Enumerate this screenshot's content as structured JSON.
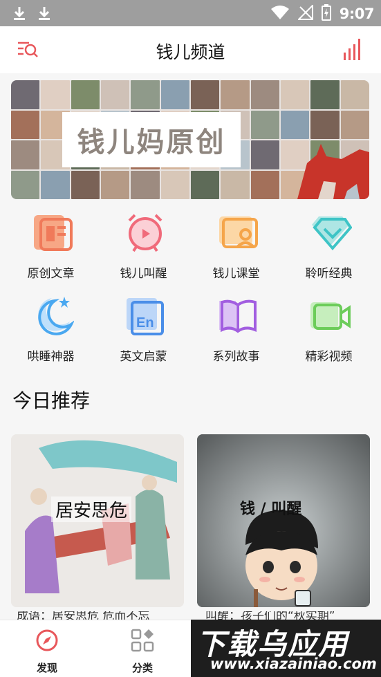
{
  "status_bar": {
    "time": "9:07"
  },
  "app_bar": {
    "title": "钱儿频道"
  },
  "banner": {
    "text": "钱儿妈原创"
  },
  "categories": [
    {
      "label": "原创文章",
      "icon": "article-icon",
      "color": "#f07a5a"
    },
    {
      "label": "钱儿叫醒",
      "icon": "alarm-clock-icon",
      "color": "#f06a7a"
    },
    {
      "label": "钱儿课堂",
      "icon": "classroom-icon",
      "color": "#f5a54a"
    },
    {
      "label": "聆听经典",
      "icon": "diamond-icon",
      "color": "#3ec4c6"
    },
    {
      "label": "哄睡神器",
      "icon": "moon-icon",
      "color": "#4aa8f0"
    },
    {
      "label": "英文启蒙",
      "icon": "english-book-icon",
      "color": "#4a8ee8"
    },
    {
      "label": "系列故事",
      "icon": "open-book-icon",
      "color": "#a25ee0"
    },
    {
      "label": "精彩视频",
      "icon": "video-camera-icon",
      "color": "#6ccc5a"
    }
  ],
  "recommend": {
    "title": "今日推荐",
    "cards": [
      {
        "image_text": "居安思危",
        "caption": "成语：居安思危 危而不忘"
      },
      {
        "image_text": "钱 / 叫醒",
        "caption": "叫醒：孩子们的“秋实期”"
      }
    ]
  },
  "tabbar": {
    "items": [
      {
        "label": "发现",
        "icon": "compass-icon"
      },
      {
        "label": "分类",
        "icon": "category-grid-icon"
      }
    ]
  },
  "watermark": {
    "main": "下载乌应用",
    "sub": "www.xiazainiao.com"
  },
  "colors": {
    "accent": "#e8575b",
    "background": "#f6f6f6"
  }
}
